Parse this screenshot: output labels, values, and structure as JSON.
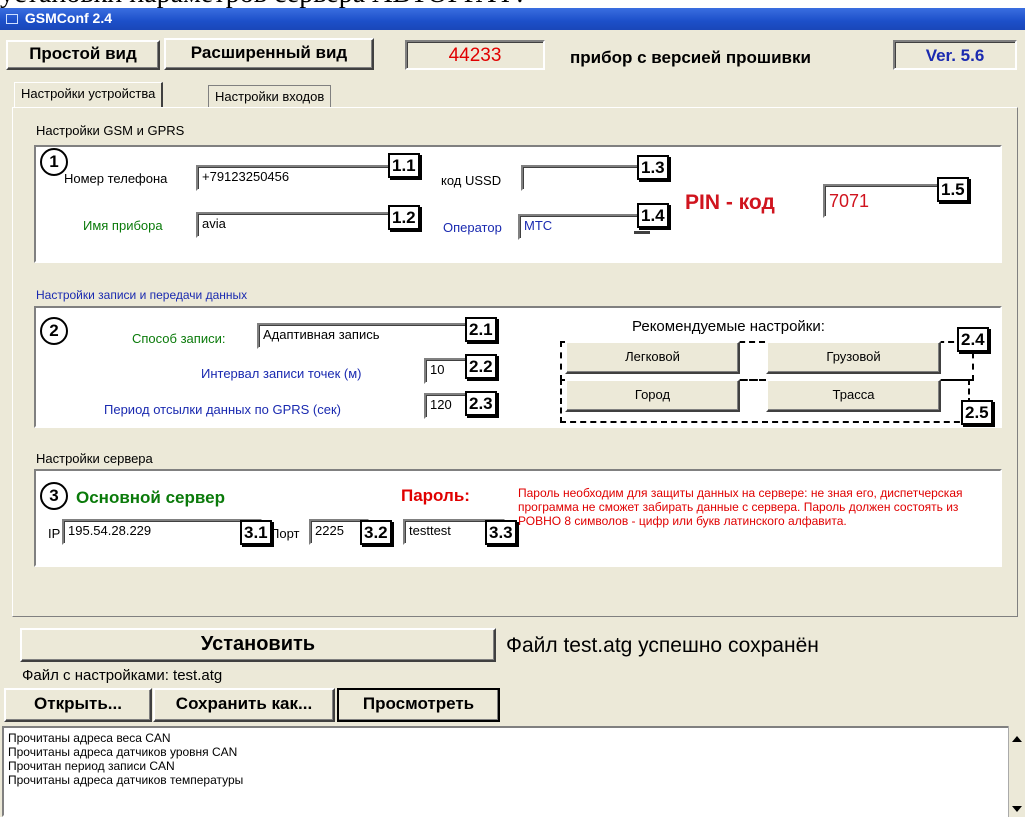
{
  "doc_caption": "установки параметров сервера АВТОГРАФ.",
  "window_title": "GSMConf 2.4",
  "top_bar": {
    "simple_view": "Простой вид",
    "advanced_view": "Расширенный вид",
    "device_number": "44233",
    "firmware_label": "прибор с версией прошивки",
    "version": "Ver. 5.6"
  },
  "tabs": [
    "Настройки устройства",
    "Настройки входов"
  ],
  "gsm": {
    "section_title": "Настройки GSM и GPRS",
    "circle": "1",
    "phone_label": "Номер телефона",
    "phone_value": "+79123250456",
    "phone_tag": "1.1",
    "name_label": "Имя прибора",
    "name_value": "avia",
    "name_tag": "1.2",
    "ussd_label": "код USSD",
    "ussd_value": "",
    "ussd_tag": "1.3",
    "operator_label": "Оператор",
    "operator_value": "МТС",
    "operator_tag": "1.4",
    "pin_label": "PIN - код",
    "pin_value": "7071",
    "pin_tag": "1.5"
  },
  "record": {
    "section_title": "Настройки записи и передачи данных",
    "circle": "2",
    "method_label": "Способ записи:",
    "method_value": "Адаптивная запись",
    "method_tag": "2.1",
    "interval_label": "Интервал записи точек (м)",
    "interval_value": "10",
    "interval_tag": "2.2",
    "period_label": "Период отсылки данных по GPRS (сек)",
    "period_value": "120",
    "period_tag": "2.3",
    "recommended_label": "Рекомендуемые настройки:",
    "btn_car": "Легковой",
    "btn_truck": "Грузовой",
    "btn_city": "Город",
    "btn_highway": "Трасса",
    "tag_24": "2.4",
    "tag_25": "2.5"
  },
  "server": {
    "section_title": "Настройки сервера",
    "circle": "3",
    "main_server": "Основной сервер",
    "password_label": "Пароль:",
    "ip_label": "IP",
    "ip_value": "195.54.28.229",
    "ip_tag": "3.1",
    "port_label": "Порт",
    "port_value": "2225",
    "port_tag": "3.2",
    "password_value": "testtest",
    "password_tag": "3.3",
    "password_note": "Пароль необходим для защиты данных на сервере: не зная его, диспетчерская программа не сможет забирать данные с сервера. Пароль должен состоять из РОВНО 8 символов - цифр или букв латинского алфавита."
  },
  "bottom": {
    "install_button": "Установить",
    "saved_message": "Файл test.atg успешно сохранён",
    "settings_file": "Файл с настройками: test.atg",
    "open_button": "Открыть...",
    "save_as_button": "Сохранить как...",
    "view_button": "Просмотреть"
  },
  "log": [
    "Прочитаны адреса веса CAN",
    "Прочитаны адреса датчиков уровня CAN",
    "Прочитан период записи CAN",
    "Прочитаны адреса датчиков температуры"
  ],
  "colors": {
    "device_number": "#e00000",
    "pin": "#d0141e",
    "green_label": "#0a7a0a",
    "blue_label": "#1a2ab0",
    "red_note": "#e00000",
    "title_bar": "#1c4fc9"
  }
}
